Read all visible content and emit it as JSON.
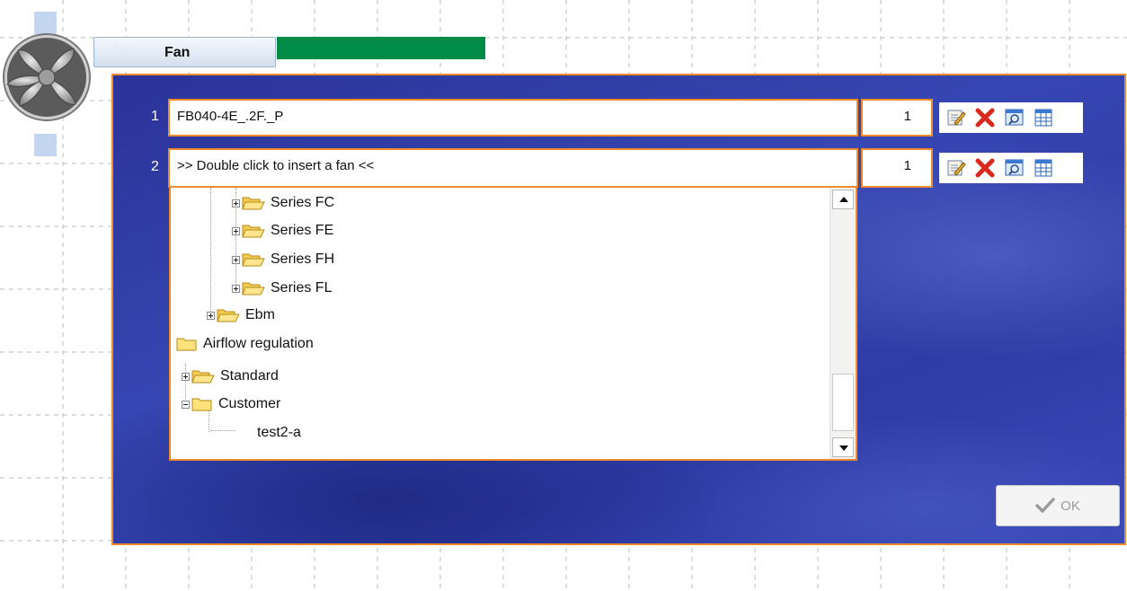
{
  "fan_node": {
    "ghost_label": "Fan ...",
    "title": "Fan",
    "status_color": "#008c46"
  },
  "rows": [
    {
      "number": "1",
      "value": "FB040-4E_.2F._P",
      "quantity": "1"
    },
    {
      "number": "2",
      "value": ">> Double click to insert a fan <<",
      "quantity": "1"
    }
  ],
  "row_tools": [
    "edit-icon",
    "delete-icon",
    "search-icon",
    "grid-icon"
  ],
  "tree": {
    "items": [
      {
        "label": "Series FC",
        "expander": "plus"
      },
      {
        "label": "Series FE",
        "expander": "plus"
      },
      {
        "label": "Series FH",
        "expander": "plus"
      },
      {
        "label": "Series FL",
        "expander": "plus"
      },
      {
        "label": "Ebm",
        "expander": "plus"
      },
      {
        "label": "Airflow regulation",
        "expander": "none"
      },
      {
        "label": "Standard",
        "expander": "plus"
      },
      {
        "label": "Customer",
        "expander": "minus"
      },
      {
        "label": "test2-a",
        "expander": "none"
      }
    ]
  },
  "ok_button": {
    "label": "OK"
  },
  "colors": {
    "accent_border": "#ee8a2a",
    "panel_blue": "#3240a8"
  }
}
